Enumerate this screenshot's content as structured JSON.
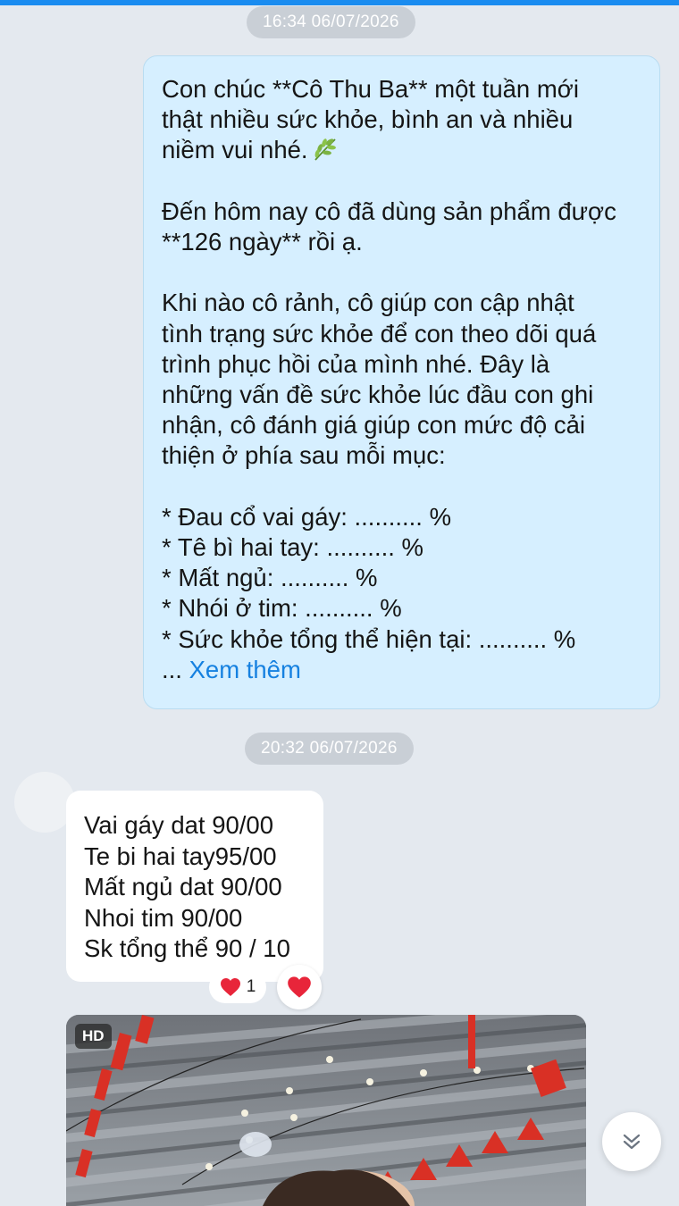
{
  "chat": {
    "timestamps": [
      "16:34 06/07/2026",
      "20:32 06/07/2026"
    ],
    "sent_message": {
      "lines": [
        "Con chúc **Cô Thu Ba** một tuần mới",
        "thật nhiều sức khỏe, bình an và nhiều",
        "niềm vui nhé.",
        "",
        "Đến hôm nay cô đã dùng sản phẩm được",
        "**126 ngày** rồi ạ.",
        "",
        "Khi nào cô rảnh, cô giúp con cập nhật",
        "tình trạng sức khỏe để con theo dõi quá",
        "trình phục hồi của mình nhé. Đây là",
        "những vấn đề sức khỏe lúc đầu con ghi",
        "nhận, cô đánh giá giúp con mức độ cải",
        "thiện ở phía sau mỗi mục:",
        "",
        "* Đau cổ vai gáy: .......... %",
        "* Tê bì hai tay: .......... %",
        "* Mất ngủ: .......... %",
        "* Nhói ở tim: .......... %",
        "* Sức khỏe tổng thể hiện tại: .......... %"
      ],
      "ellipsis": "...",
      "see_more": "Xem thêm",
      "emoji_icon": "leaf-icon"
    },
    "received_message": {
      "lines": [
        "Vai gáy dat 90/00",
        "Te bi hai tay95/00",
        "Mất ngủ dat 90/00",
        "Nhoi tim 90/00",
        "Sk tổng thể 90 / 10"
      ],
      "reaction_count": "1"
    },
    "photo": {
      "badge": "HD"
    }
  },
  "colors": {
    "accent": "#1a8cf0",
    "sent_bubble": "#d6efff",
    "link": "#1681e0",
    "heart": "#e8253a"
  }
}
